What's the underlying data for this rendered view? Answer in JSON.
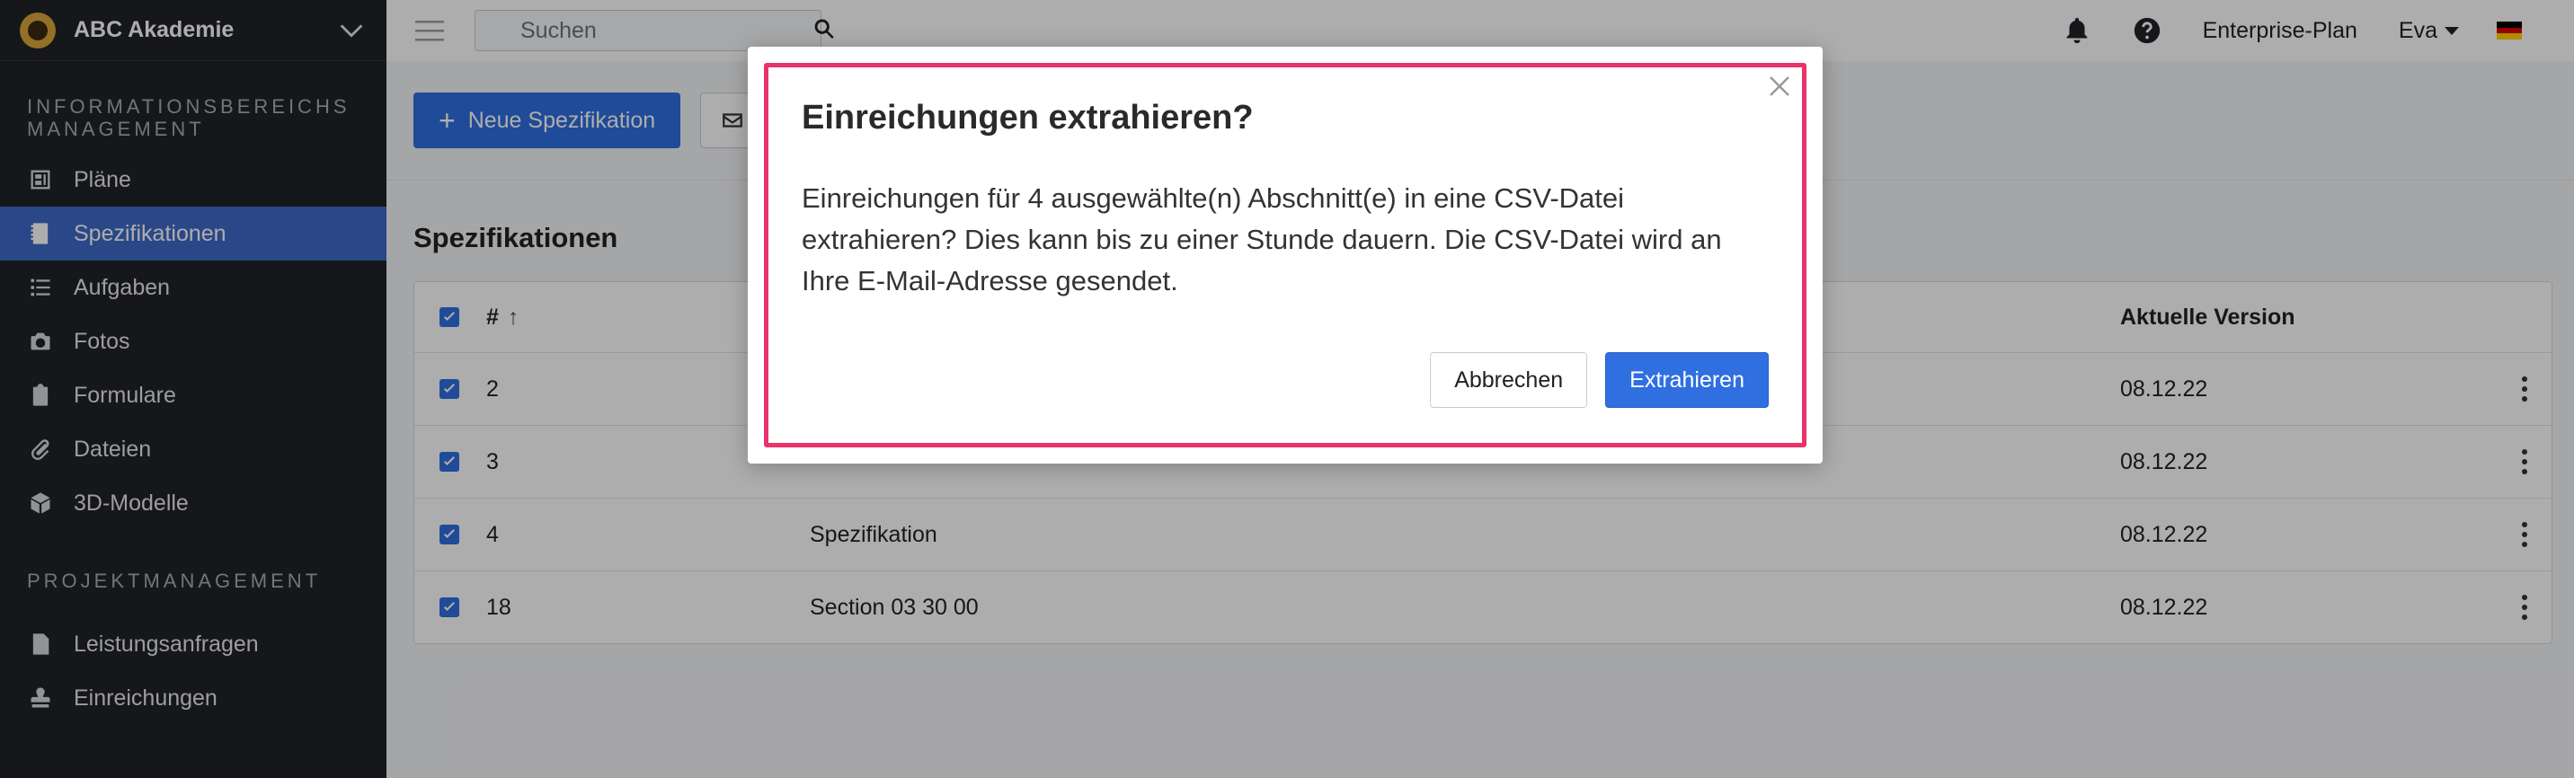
{
  "sidebar": {
    "org_name": "ABC Akademie",
    "section_info": "Informationsbereichs Management",
    "section_project": "Projektmanagement",
    "items_info": [
      {
        "label": "Pläne",
        "icon": "plans-icon"
      },
      {
        "label": "Spezifikationen",
        "icon": "specifications-icon",
        "active": true
      },
      {
        "label": "Aufgaben",
        "icon": "tasks-icon"
      },
      {
        "label": "Fotos",
        "icon": "camera-icon"
      },
      {
        "label": "Formulare",
        "icon": "clipboard-icon"
      },
      {
        "label": "Dateien",
        "icon": "paperclip-icon"
      },
      {
        "label": "3D-Modelle",
        "icon": "cube-icon"
      }
    ],
    "items_project": [
      {
        "label": "Leistungsanfragen",
        "icon": "file-info-icon"
      },
      {
        "label": "Einreichungen",
        "icon": "stamp-icon"
      }
    ]
  },
  "topbar": {
    "search_placeholder": "Suchen",
    "plan_label": "Enterprise-Plan",
    "user_name": "Eva",
    "language": "de"
  },
  "main": {
    "new_button_label": "Neue Spezifikation",
    "page_title": "Spezifikationen",
    "table": {
      "col_number": "#",
      "col_version": "Aktuelle Version",
      "rows": [
        {
          "number": "2",
          "name": "",
          "version": "08.12.22",
          "checked": true
        },
        {
          "number": "3",
          "name": "",
          "version": "08.12.22",
          "checked": true
        },
        {
          "number": "4",
          "name": "Spezifikation",
          "version": "08.12.22",
          "checked": true
        },
        {
          "number": "18",
          "name": "Section 03 30 00",
          "version": "08.12.22",
          "checked": true
        }
      ]
    }
  },
  "modal": {
    "title": "Einreichungen extrahieren?",
    "body": "Einreichungen für 4 ausgewählte(n) Abschnitt(e) in eine CSV-Datei extrahieren? Dies kann bis zu einer Stunde dauern. Die CSV-Datei wird an Ihre E-Mail-Adresse gesendet.",
    "cancel_label": "Abbrechen",
    "confirm_label": "Extrahieren"
  },
  "colors": {
    "accent": "#2f6fe0",
    "sidebar_bg": "#1f2227",
    "sidebar_active": "#3f6bc9",
    "highlight": "#e8336b"
  }
}
